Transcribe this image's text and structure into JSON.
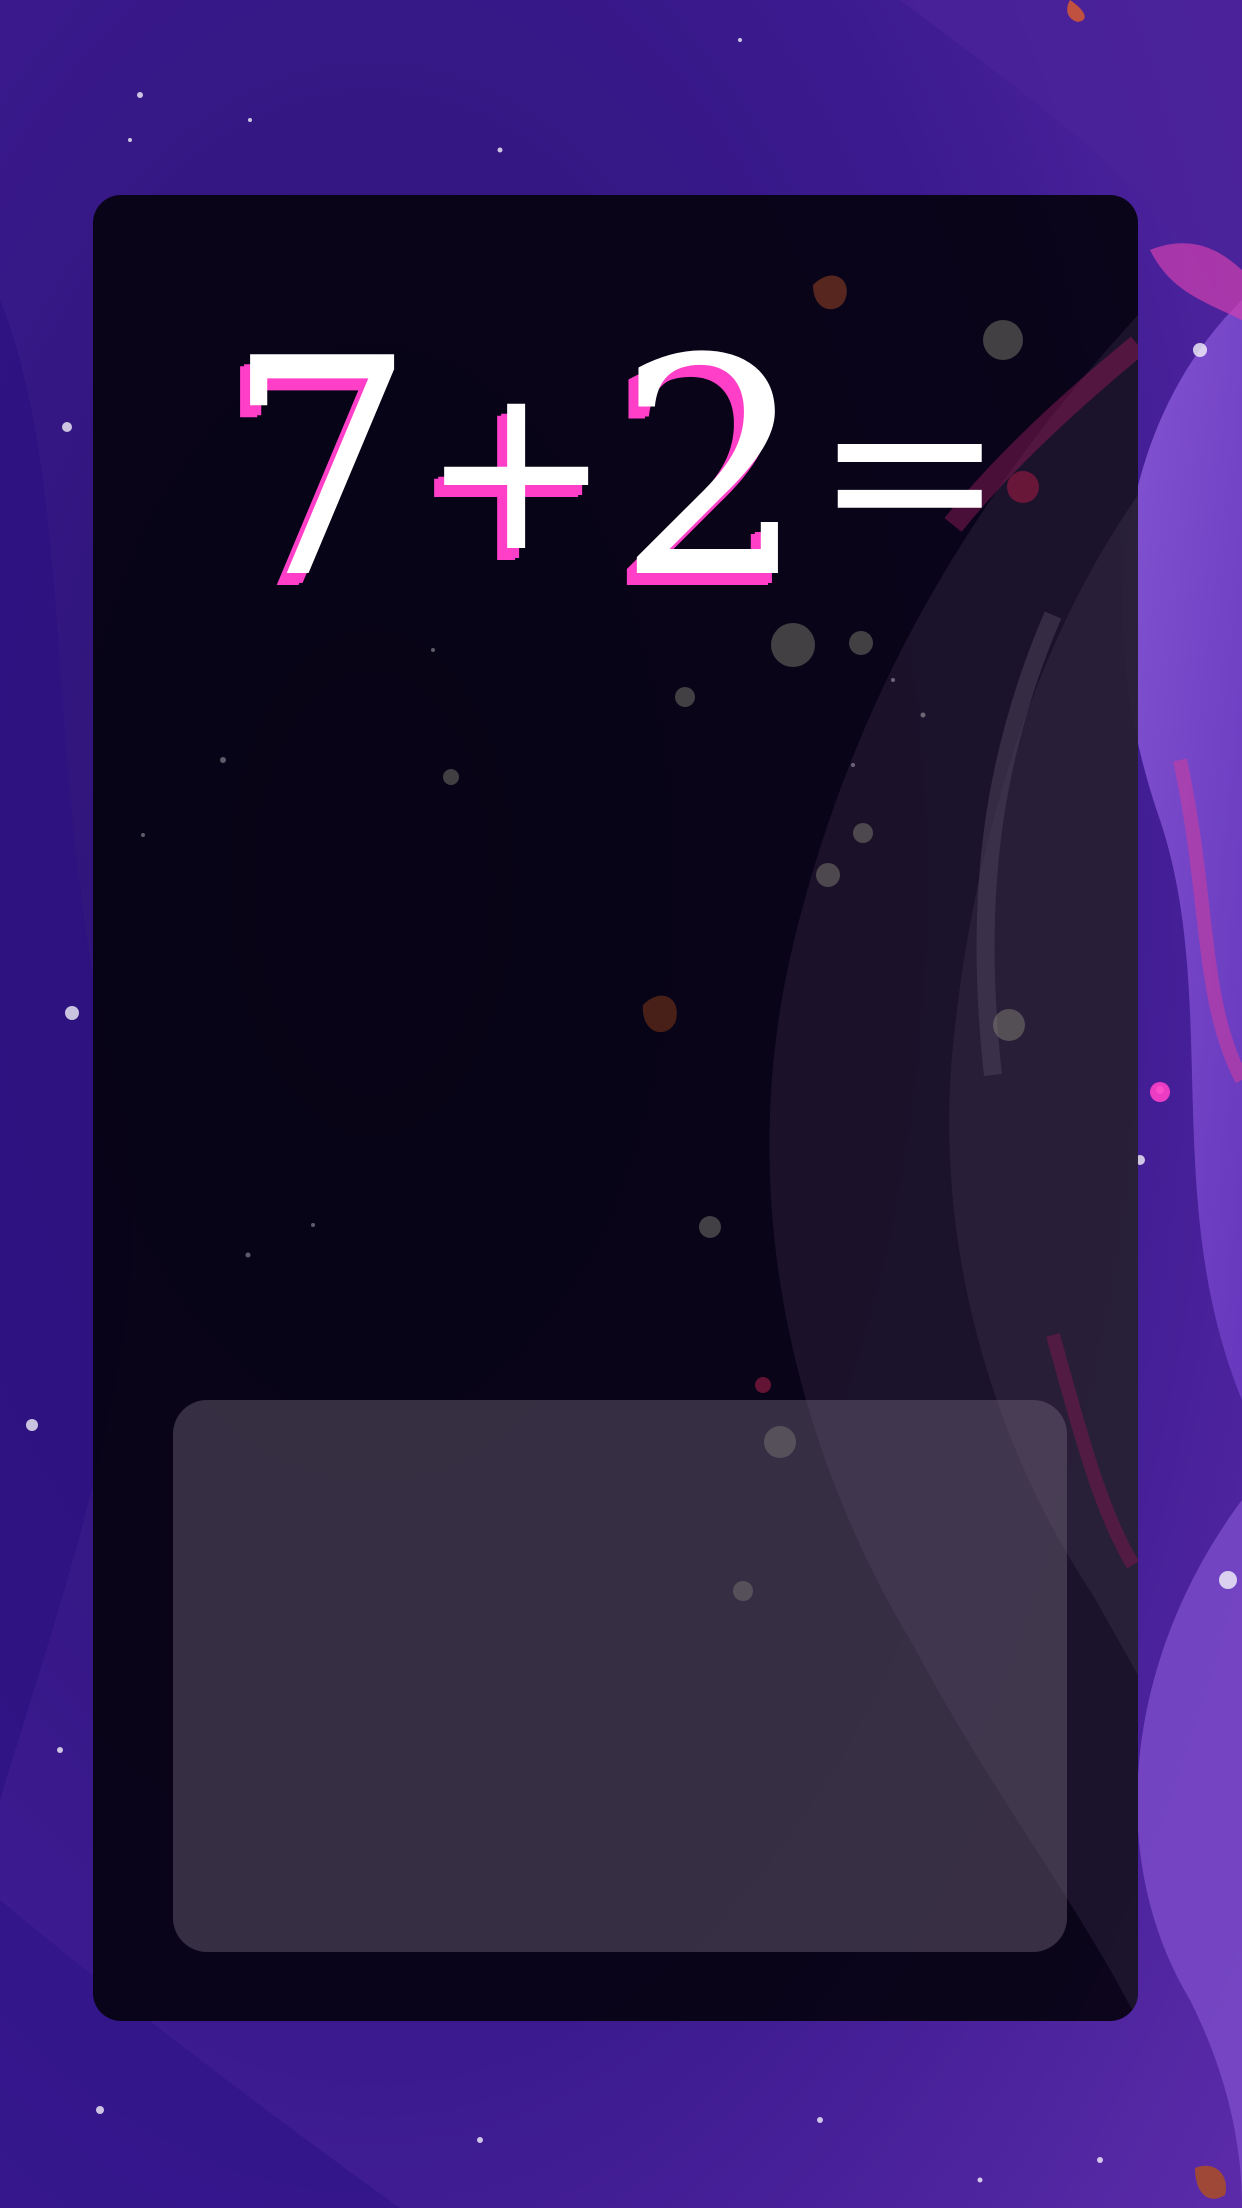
{
  "equation": {
    "operand_a": "7",
    "operator": "+",
    "operand_b": "2",
    "equals": "="
  },
  "answer_area": {
    "value": ""
  },
  "colors": {
    "background": "#3a1a8a",
    "panel": "#05020c",
    "equation_text": "#ffffff",
    "equation_shadow": "#ff3fc8",
    "answer_area": "#6e6478"
  }
}
